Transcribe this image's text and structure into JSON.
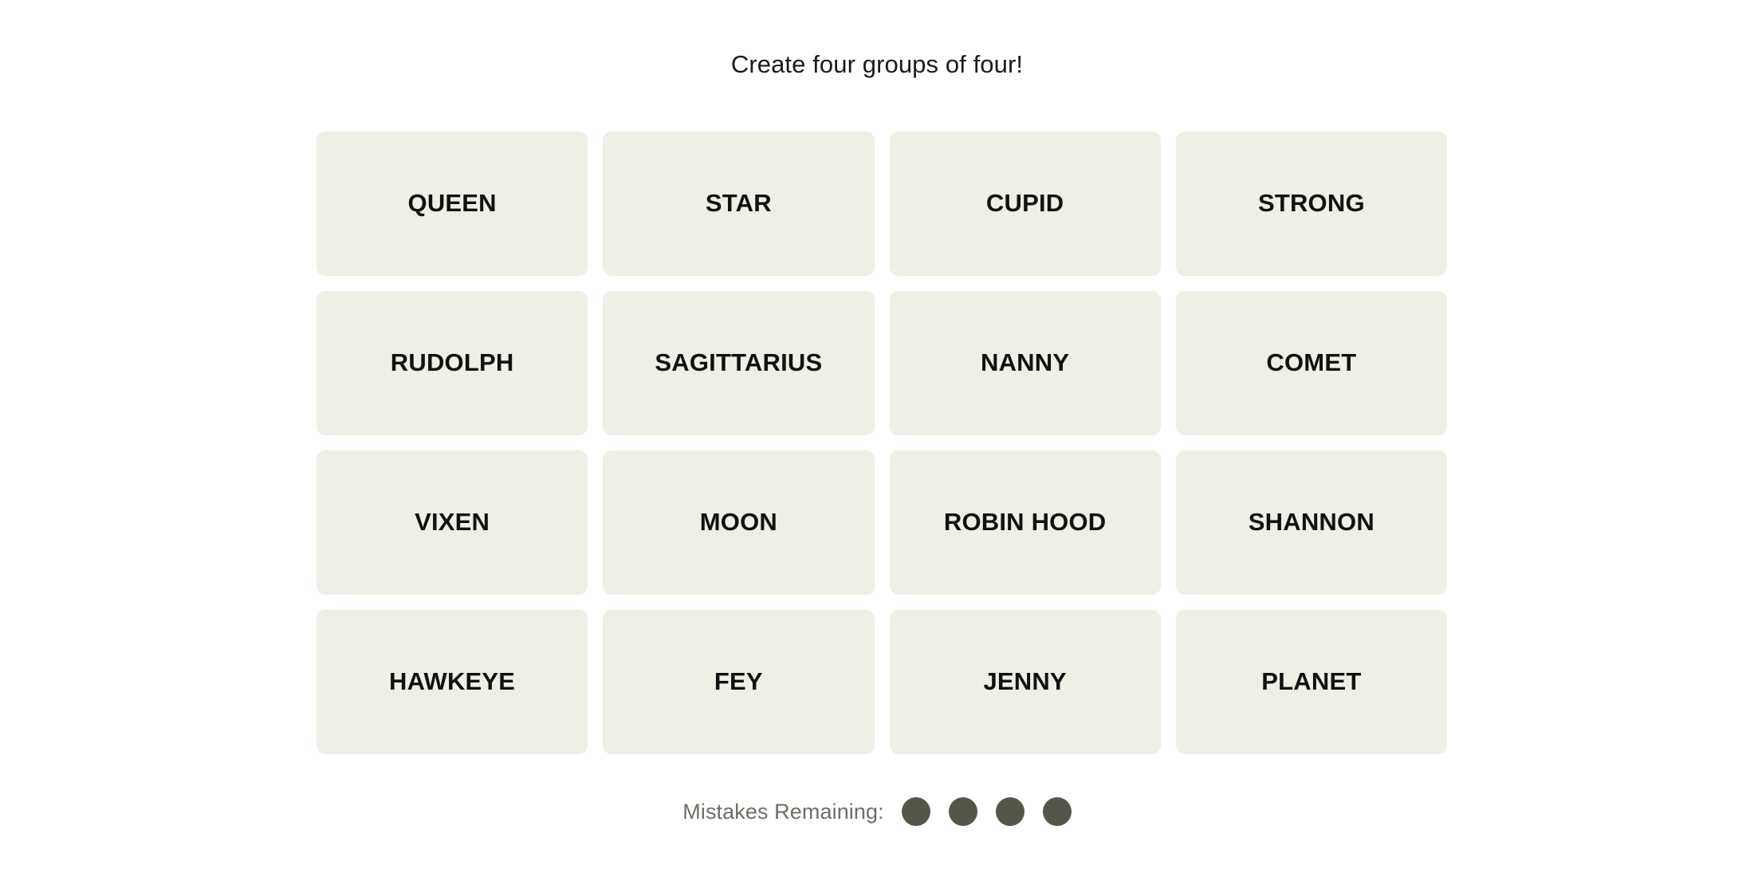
{
  "page": {
    "background_color": "#ffffff"
  },
  "header": {
    "instruction": "Create four groups of four!"
  },
  "board": {
    "rows": 4,
    "columns": 4,
    "tile_color": "#efefe6",
    "tile_text_color": "#111111",
    "tiles": [
      {
        "label": "QUEEN"
      },
      {
        "label": "STAR"
      },
      {
        "label": "CUPID"
      },
      {
        "label": "STRONG"
      },
      {
        "label": "RUDOLPH"
      },
      {
        "label": "SAGITTARIUS"
      },
      {
        "label": "NANNY"
      },
      {
        "label": "COMET"
      },
      {
        "label": "VIXEN"
      },
      {
        "label": "MOON"
      },
      {
        "label": "ROBIN HOOD"
      },
      {
        "label": "SHANNON"
      },
      {
        "label": "HAWKEYE"
      },
      {
        "label": "FEY"
      },
      {
        "label": "JENNY"
      },
      {
        "label": "PLANET"
      }
    ]
  },
  "footer": {
    "mistakes_label": "Mistakes Remaining:",
    "mistakes_remaining": 4,
    "dot_color": "#55554a",
    "label_color": "#6e6e66",
    "dots": [
      {
        "name": "mistake-dot-1"
      },
      {
        "name": "mistake-dot-2"
      },
      {
        "name": "mistake-dot-3"
      },
      {
        "name": "mistake-dot-4"
      }
    ]
  }
}
